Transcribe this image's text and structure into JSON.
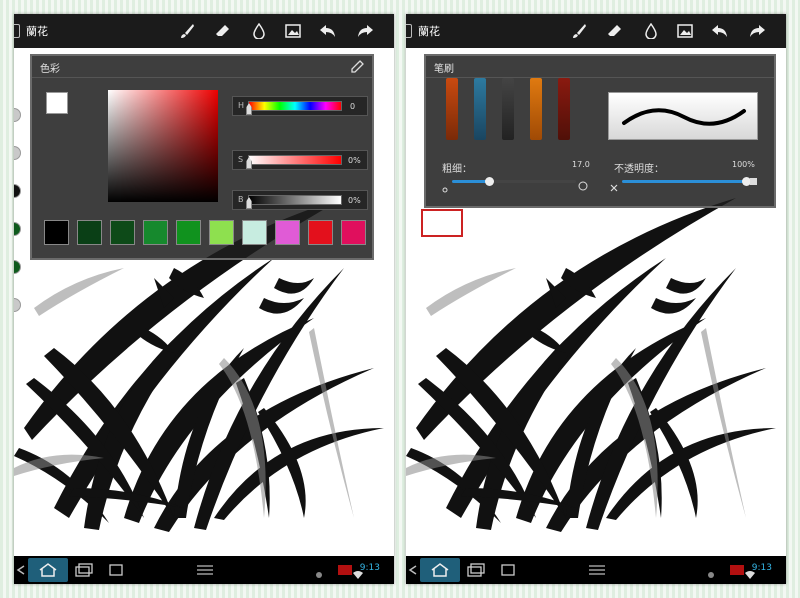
{
  "screens": [
    {
      "title": "蘭花",
      "panel": {
        "title": "色彩",
        "sliders": [
          {
            "label": "H",
            "value": "0",
            "fraction": 0.0
          },
          {
            "label": "S",
            "value": "0%",
            "fraction": 0.0
          },
          {
            "label": "B",
            "value": "0%",
            "fraction": 0.0
          }
        ],
        "swatches": [
          "#000000",
          "#0a3f16",
          "#0d4a18",
          "#16892d",
          "#10921e",
          "#8ee04f",
          "#c7ece0",
          "#e05bd6",
          "#e3101c",
          "#e00f5d"
        ]
      },
      "clock": "9:13"
    },
    {
      "title": "蘭花",
      "panel": {
        "title": "笔刷",
        "size_label": "粗细：",
        "size_value": "17.0",
        "size_fraction": 0.3,
        "opacity_label": "不透明度：",
        "opacity_value": "100%",
        "opacity_fraction": 1.0
      },
      "clock": "9:13"
    }
  ],
  "icons": {
    "toolbar": [
      "brush-icon",
      "eraser-icon",
      "ink-drop-icon",
      "image-icon",
      "undo-icon",
      "redo-icon"
    ],
    "nav": [
      "back-icon",
      "home-icon",
      "recent-apps-icon",
      "screenshot-icon",
      "menu-icon"
    ]
  },
  "colors": {
    "accent": "#2b8fd8",
    "clock": "#35b5e5"
  }
}
